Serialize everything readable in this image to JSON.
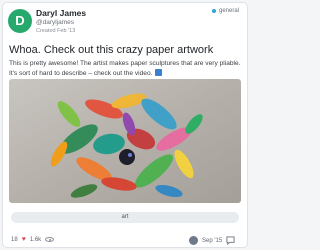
{
  "post": {
    "avatar_letter": "D",
    "author": "Daryl James",
    "handle": "@daryljames",
    "created": "Created Feb '13",
    "channel": "general",
    "title": "Whoa. Check out this crazy paper artwork",
    "body_line1": "This is pretty awesome! The artist makes paper sculptures that are very pliable.",
    "body_line2": "It's sort of hard to describe – check out the video.",
    "tag": "art"
  },
  "stats": {
    "likes": "18",
    "views": "1.6k"
  },
  "footer": {
    "date": "Sep '15"
  },
  "colors": {
    "avatar": "#27a96e",
    "channel_dot": "#2ea5d8",
    "heart": "#e24a5c"
  }
}
